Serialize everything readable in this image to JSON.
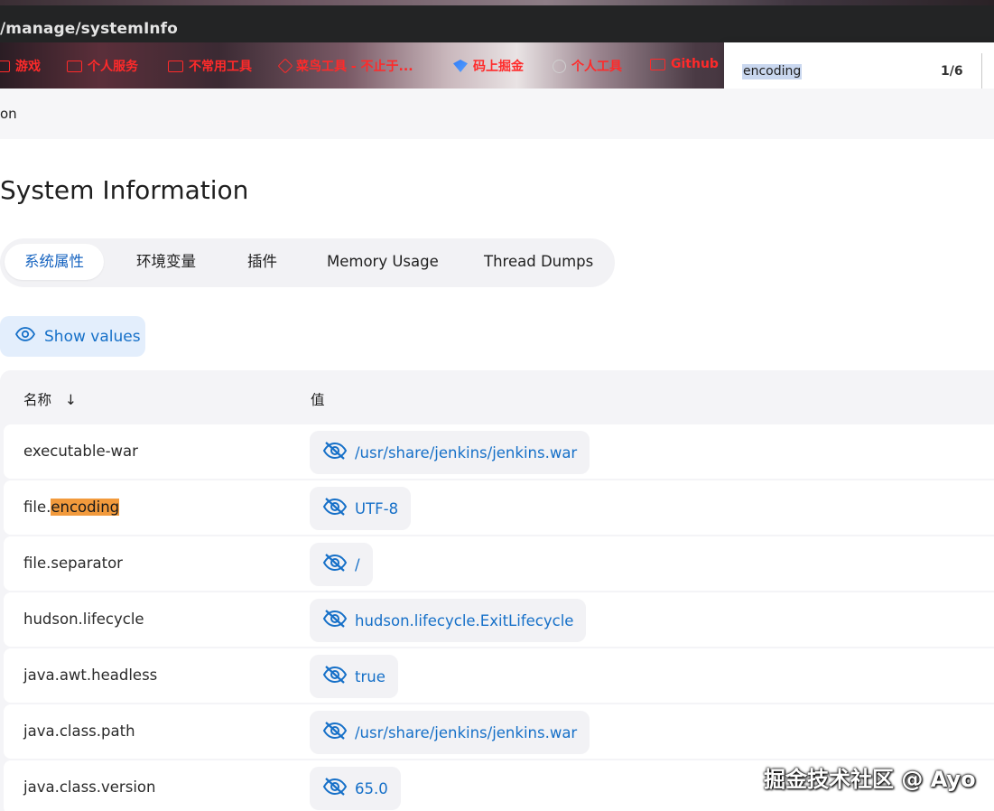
{
  "browser": {
    "url": "/manage/systemInfo",
    "bookmarks": [
      {
        "label": "游戏",
        "icon": "folder-icon"
      },
      {
        "label": "个人服务",
        "icon": "folder-icon"
      },
      {
        "label": "不常用工具",
        "icon": "folder-icon"
      },
      {
        "label": "菜鸟工具 - 不止于...",
        "icon": "cube-icon"
      },
      {
        "label": "码上掘金",
        "icon": "juejin-icon"
      },
      {
        "label": "个人工具",
        "icon": "globe-icon"
      },
      {
        "label": "Github",
        "icon": "folder-icon"
      }
    ]
  },
  "find": {
    "query": "encoding",
    "count": "1/6"
  },
  "breadcrumb": "on",
  "page": {
    "title": "System Information"
  },
  "tabs": [
    {
      "label": "系统属性",
      "active": true
    },
    {
      "label": "环境变量",
      "active": false
    },
    {
      "label": "插件",
      "active": false
    },
    {
      "label": "Memory Usage",
      "active": false
    },
    {
      "label": "Thread Dumps",
      "active": false
    }
  ],
  "show_values": {
    "label": "Show values",
    "icon": "eye-icon"
  },
  "table": {
    "headers": {
      "name": "名称",
      "sort_indicator": "↓",
      "value": "值"
    },
    "rows": [
      {
        "name_prefix": "executable-war",
        "name_highlight": "",
        "value": "/usr/share/jenkins/jenkins.war"
      },
      {
        "name_prefix": "file.",
        "name_highlight": "encoding",
        "value": "UTF-8"
      },
      {
        "name_prefix": "file.separator",
        "name_highlight": "",
        "value": "/"
      },
      {
        "name_prefix": "hudson.lifecycle",
        "name_highlight": "",
        "value": "hudson.lifecycle.ExitLifecycle"
      },
      {
        "name_prefix": "java.awt.headless",
        "name_highlight": "",
        "value": "true"
      },
      {
        "name_prefix": "java.class.path",
        "name_highlight": "",
        "value": "/usr/share/jenkins/jenkins.war"
      },
      {
        "name_prefix": "java.class.version",
        "name_highlight": "",
        "value": "65.0"
      }
    ]
  },
  "watermark": "掘金技术社区 @ Ayo",
  "colors": {
    "accent": "#1670c8",
    "highlight": "#f29a3c",
    "bookmark_text": "#ff2a2a"
  }
}
